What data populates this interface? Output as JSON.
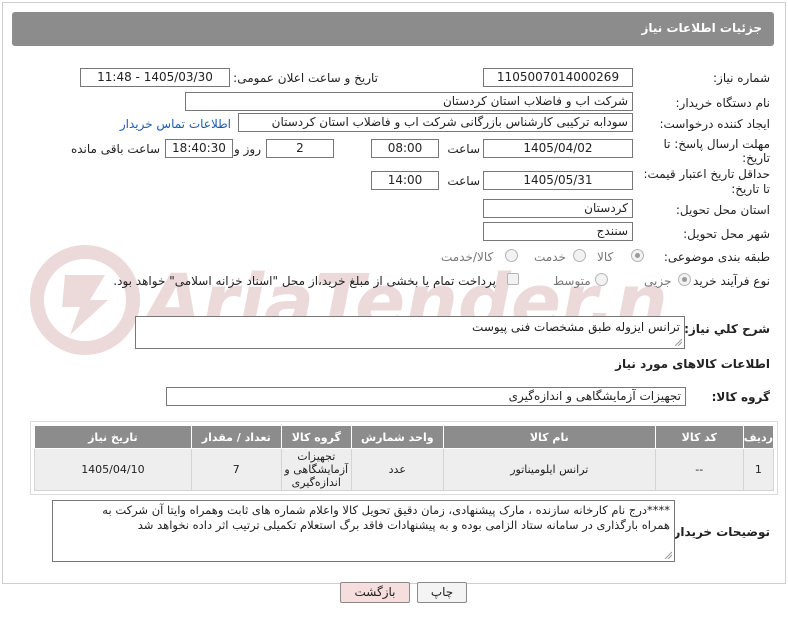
{
  "header": {
    "title": "جزئیات اطلاعات نیاز"
  },
  "fields": {
    "need_number": {
      "label": "شماره نیاز:",
      "value": "1105007014000269"
    },
    "announce_datetime": {
      "label": "تاریخ و ساعت اعلان عمومی:",
      "value": "1405/03/30 - 11:48"
    },
    "buyer_org": {
      "label": "نام دستگاه خریدار:",
      "value": "شرکت اب و فاضلاب استان کردستان"
    },
    "requester": {
      "label": "ایجاد کننده درخواست:",
      "value": "سودابه ترکیبی کارشناس بازرگانی شرکت اب و فاضلاب استان کردستان",
      "contact_link": "اطلاعات تماس خریدار"
    },
    "reply_deadline": {
      "label_line1": "مهلت ارسال پاسخ: تا",
      "label_line2": "تاریخ:",
      "date": "1405/04/02",
      "time_label": "ساعت",
      "time": "08:00",
      "days": "2",
      "days_label": "روز و",
      "remaining": "18:40:30",
      "remaining_label": "ساعت باقی مانده"
    },
    "price_validity": {
      "label_line1": "حداقل تاریخ اعتبار قیمت:",
      "label_line2": "تا تاریخ:",
      "date": "1405/05/31",
      "time_label": "ساعت",
      "time": "14:00"
    },
    "delivery_province": {
      "label": "استان محل تحویل:",
      "value": "کردستان"
    },
    "delivery_city": {
      "label": "شهر محل تحویل:",
      "value": "سنندج"
    },
    "category": {
      "label": "طبقه بندی موضوعی:",
      "options": [
        "کالا",
        "خدمت",
        "کالا/خدمت"
      ],
      "selected": "کالا"
    },
    "purchase_type": {
      "label": "نوع فرآیند خرید :",
      "options": [
        "جزیی",
        "متوسط"
      ],
      "selected": "جزیی",
      "note": "پرداخت تمام یا بخشی از مبلغ خرید،از محل \"اسناد خزانه اسلامی\" خواهد بود."
    },
    "general_desc": {
      "label": "شرح کلي نياز:",
      "value": "ترانس ایزوله طبق مشخصات فنی پیوست"
    }
  },
  "goods": {
    "section_title": "اطلاعات کالاهای مورد نیاز",
    "group_label": "گروه کالا:",
    "group_value": "تجهیزات آزمایشگاهی و اندازه‌گیری",
    "columns": [
      "ردیف",
      "کد کالا",
      "نام کالا",
      "واحد شمارش",
      "گروه کالا",
      "تعداد / مقدار",
      "تاریخ نیاز"
    ],
    "rows": [
      {
        "row": "1",
        "code": "--",
        "name": "ترانس ایلومیناتور",
        "unit": "عدد",
        "group_l1": "تجهیزات",
        "group_l2": "آزمایشگاهی و",
        "group_l3": "اندازه‌گیری",
        "qty": "7",
        "date": "1405/04/10"
      }
    ]
  },
  "buyer_notes": {
    "label": "توضیحات خریدار:",
    "line1": "****درج نام کارخانه سازنده ، مارک پیشنهادی، زمان دقیق تحویل کالا واعلام شماره های ثابت وهمراه وایتا آن شرکت به",
    "line2": "همراه بارگذاری در سامانه ستاد الزامی بوده و به پیشنهادات فاقد برگ استعلام تکمیلی ترتیب اثر داده نخواهد شد"
  },
  "buttons": {
    "print": "چاپ",
    "back": "بازگشت"
  },
  "watermark": {
    "text": "AriaTender.net",
    "color": "#e8d4d4"
  },
  "colors": {
    "header_bg": "#8c8c8c",
    "link": "#1a5db5",
    "back_button_bg": "#f6dede"
  }
}
